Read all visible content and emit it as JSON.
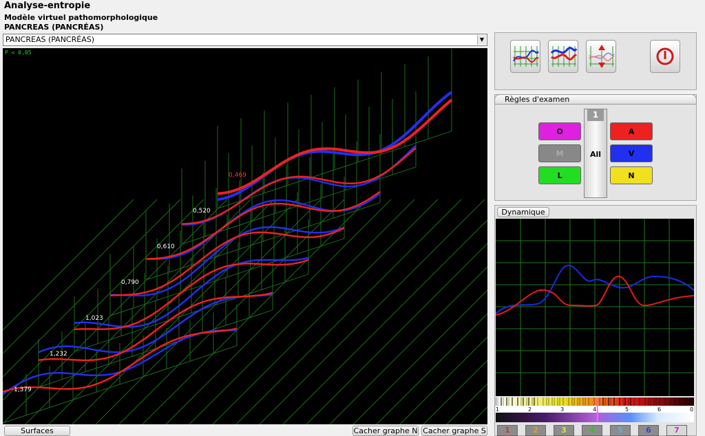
{
  "header": {
    "app_title": "Analyse-entropie",
    "model_title": "Modèle virtuel pathomorphologique",
    "organ_title": "PANCREAS  (PANCRÉAS)"
  },
  "organ_select": {
    "value": "PANCREAS  (PANCRÉAS)"
  },
  "graph3d": {
    "p_value": "P < 0,05",
    "values": [
      {
        "label": "1,379",
        "color": "#ffffff"
      },
      {
        "label": "1,232",
        "color": "#ffffff"
      },
      {
        "label": "1,023",
        "color": "#ffffff"
      },
      {
        "label": "0,790",
        "color": "#ffffff"
      },
      {
        "label": "0,610",
        "color": "#ffffff"
      },
      {
        "label": "0,520",
        "color": "#ffffff"
      },
      {
        "label": "0,469",
        "color": "#ff3030"
      }
    ]
  },
  "bottom_buttons": {
    "surfaces": "Surfaces",
    "hide_n": "Cacher graphe N",
    "hide_s": "Cacher graphe S"
  },
  "rules_panel": {
    "title": "Règles d'examen",
    "counter": "1",
    "all_label": "All",
    "left_buttons": [
      {
        "label": "O",
        "color": "#e020e0",
        "disabled": false
      },
      {
        "label": "M",
        "color": "#888888",
        "disabled": true
      },
      {
        "label": "L",
        "color": "#22dd22",
        "disabled": false
      }
    ],
    "right_buttons": [
      {
        "label": "A",
        "color": "#ee2020"
      },
      {
        "label": "V",
        "color": "#2030ee"
      },
      {
        "label": "N",
        "color": "#f0e020"
      }
    ]
  },
  "dynamics": {
    "tab_label": "Dynamique",
    "scale_labels": [
      "1",
      "2",
      "3",
      "4",
      "5",
      "6",
      "0"
    ],
    "marker_value": 4.1,
    "buttons": [
      {
        "label": "1",
        "color": "#d83030"
      },
      {
        "label": "2",
        "color": "#e8a020"
      },
      {
        "label": "3",
        "color": "#e8e020"
      },
      {
        "label": "4",
        "color": "#30c030"
      },
      {
        "label": "5",
        "color": "#30c8e8"
      },
      {
        "label": "6",
        "color": "#3040e8"
      },
      {
        "label": "7",
        "color": "#c030c0"
      }
    ]
  }
}
